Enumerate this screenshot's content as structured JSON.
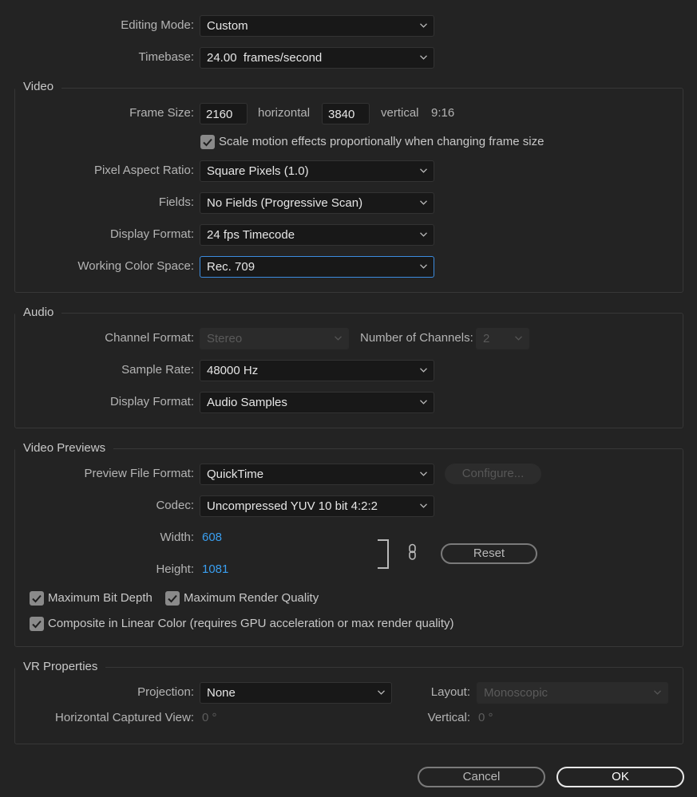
{
  "general": {
    "editing_mode": {
      "label": "Editing Mode:",
      "value": "Custom"
    },
    "timebase": {
      "label": "Timebase:",
      "value": "24.00  frames/second"
    }
  },
  "video": {
    "title": "Video",
    "frame_size": {
      "label": "Frame Size:",
      "horizontal": "2160",
      "horizontal_label": "horizontal",
      "vertical": "3840",
      "vertical_label": "vertical",
      "ratio": "9:16"
    },
    "scale_motion": {
      "label": "Scale motion effects proportionally when changing frame size",
      "checked": true
    },
    "pixel_aspect_ratio": {
      "label": "Pixel Aspect Ratio:",
      "value": "Square Pixels (1.0)"
    },
    "fields": {
      "label": "Fields:",
      "value": "No Fields (Progressive Scan)"
    },
    "display_format": {
      "label": "Display Format:",
      "value": "24 fps Timecode"
    },
    "working_color_space": {
      "label": "Working Color Space:",
      "value": "Rec. 709"
    }
  },
  "audio": {
    "title": "Audio",
    "channel_format": {
      "label": "Channel Format:",
      "value": "Stereo",
      "disabled": true
    },
    "number_of_channels": {
      "label": "Number of Channels:",
      "value": "2",
      "disabled": true
    },
    "sample_rate": {
      "label": "Sample Rate:",
      "value": "48000 Hz"
    },
    "display_format": {
      "label": "Display Format:",
      "value": "Audio Samples"
    }
  },
  "video_previews": {
    "title": "Video Previews",
    "preview_file_format": {
      "label": "Preview File Format:",
      "value": "QuickTime"
    },
    "configure_button": "Configure...",
    "codec": {
      "label": "Codec:",
      "value": "Uncompressed YUV 10 bit 4:2:2"
    },
    "width": {
      "label": "Width:",
      "value": "608"
    },
    "height": {
      "label": "Height:",
      "value": "1081"
    },
    "reset_button": "Reset",
    "max_bit_depth": {
      "label": "Maximum Bit Depth",
      "checked": true
    },
    "max_render_quality": {
      "label": "Maximum Render Quality",
      "checked": true
    },
    "composite_linear": {
      "label": "Composite in Linear Color (requires GPU acceleration or max render quality)",
      "checked": true
    }
  },
  "vr_properties": {
    "title": "VR Properties",
    "projection": {
      "label": "Projection:",
      "value": "None"
    },
    "layout": {
      "label": "Layout:",
      "value": "Monoscopic",
      "disabled": true
    },
    "horizontal_captured_view": {
      "label": "Horizontal Captured View:",
      "value": "0 °"
    },
    "vertical": {
      "label": "Vertical:",
      "value": "0 °"
    }
  },
  "footer": {
    "cancel": "Cancel",
    "ok": "OK"
  },
  "colors": {
    "background": "#232323",
    "accent_blue": "#3a9ff0",
    "focus_border": "#3c8cdf"
  }
}
